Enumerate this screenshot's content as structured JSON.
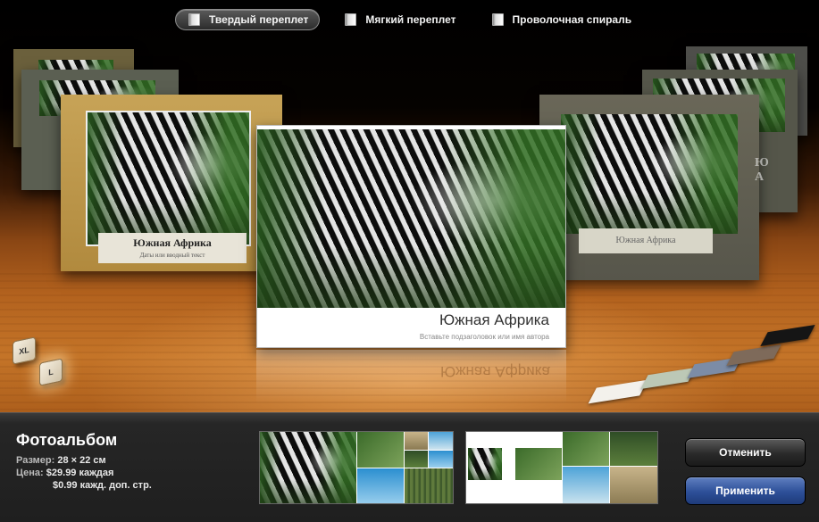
{
  "binding_options": [
    {
      "label": "Твердый переплет",
      "selected": true
    },
    {
      "label": "Мягкий переплет",
      "selected": false
    },
    {
      "label": "Проволочная спираль",
      "selected": false
    }
  ],
  "main_book": {
    "title": "Южная Африка",
    "subtitle": "Вставьте подзаголовок или имя автора"
  },
  "left_book": {
    "title": "Южная Африка",
    "subtitle": "Даты или вводный текст"
  },
  "right_book": {
    "plate": "Южная Африка",
    "side_text": "Ю\nА"
  },
  "sizes": [
    "XL",
    "L"
  ],
  "selected_size": "L",
  "cover_colors": [
    "#f3f1ec",
    "#bcc8b6",
    "#7c8ca6",
    "#7e6a5a",
    "#151515"
  ],
  "product": {
    "title": "Фотоальбом",
    "size_label": "Размер:",
    "size_value": "28 × 22 см",
    "price_label": "Цена:",
    "price_value": "$29.99 каждая",
    "extra_value": "$0.99 кажд. доп. стр."
  },
  "buttons": {
    "cancel": "Отменить",
    "apply": "Применить"
  }
}
